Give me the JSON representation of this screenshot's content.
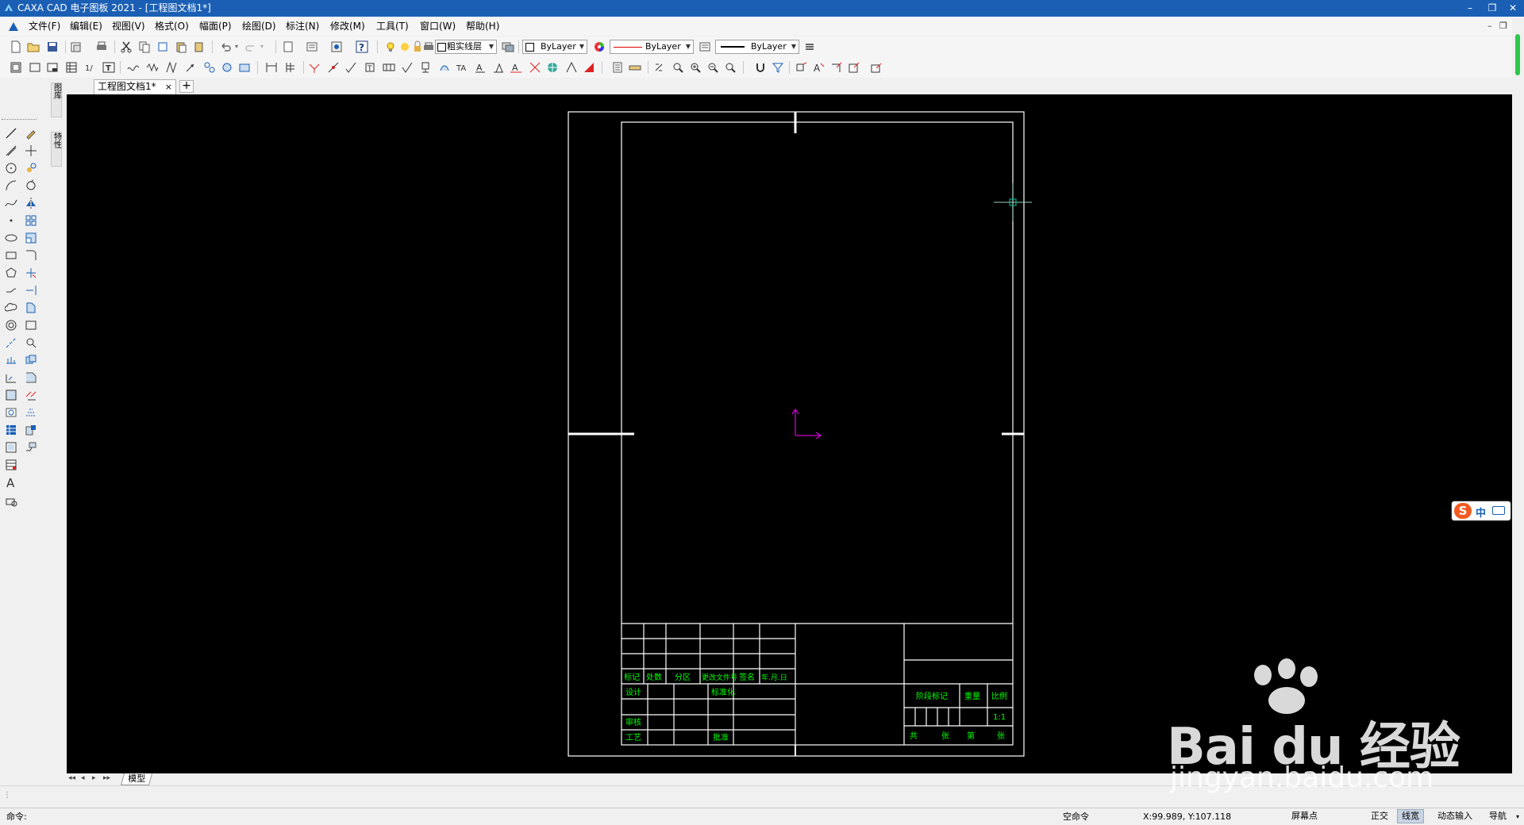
{
  "window": {
    "title": "CAXA CAD 电子图板 2021 - [工程图文档1*]",
    "controls": [
      "–",
      "❐",
      "✕"
    ]
  },
  "menu": [
    "文件(F)",
    "编辑(E)",
    "视图(V)",
    "格式(O)",
    "幅面(P)",
    "绘图(D)",
    "标注(N)",
    "修改(M)",
    "工具(T)",
    "窗口(W)",
    "帮助(H)"
  ],
  "doc_controls": [
    "–",
    "❐",
    "✕"
  ],
  "toolbar": {
    "layer_name": "粗实线层",
    "color_value": "ByLayer",
    "linetype_value": "ByLayer",
    "linewidth_value": "ByLayer"
  },
  "side_tabs": [
    "图库",
    "特性"
  ],
  "doc_tab": {
    "label": "工程图文档1*",
    "close": "×",
    "add": "+"
  },
  "sheet_tabs": {
    "nav": [
      "◂◂",
      "◂",
      "▸",
      "▸▸"
    ],
    "model": "模型"
  },
  "command": {
    "prompt": "命令:"
  },
  "status": {
    "state": "空命令",
    "coords": "X:99.989, Y:107.118",
    "screen_snap": "屏幕点",
    "ortho": "正交",
    "lineweight": "线宽",
    "dynamic_input": "动态输入",
    "navigation": "导航"
  },
  "ime": {
    "logo": "S",
    "mode": "中"
  },
  "title_block": {
    "rev_headers": [
      "标记",
      "处数",
      "分区",
      "更改文件号",
      "签名",
      "年.月.日"
    ],
    "left_rows": [
      "设计",
      "审核",
      "工艺"
    ],
    "std": "标准化",
    "approve": "批准",
    "stage_mark": "阶段标记",
    "weight": "重量",
    "scale_label": "比例",
    "scale_value": "1:1",
    "sheets": [
      "共",
      "张",
      "第",
      "张"
    ]
  },
  "watermark": {
    "brand": "Bai du 经验",
    "url": "jingyan.baidu.com"
  },
  "colors": {
    "titlebar": "#1a5fb4",
    "canvas": "#000000",
    "drawing_lines": "#ffffff",
    "title_block_text": "#00ff00",
    "ucs_axes": "#cc00cc",
    "cursor": "#00c8a0"
  }
}
